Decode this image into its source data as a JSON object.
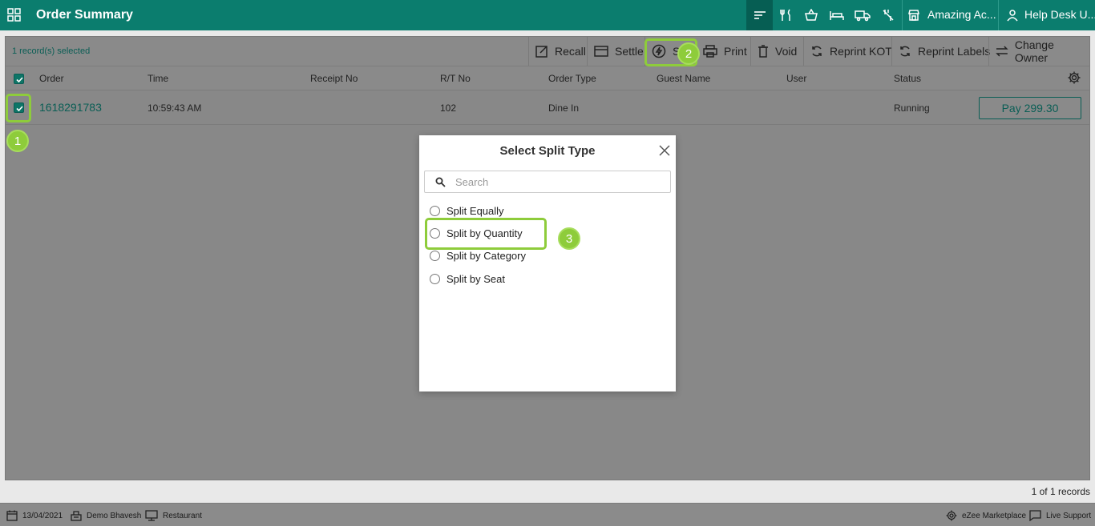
{
  "header": {
    "title": "Order Summary",
    "restaurant": "Amazing Ac...",
    "user": "Help Desk U..."
  },
  "toolbar": {
    "selected_text": "1 record(s) selected",
    "recall": "Recall",
    "settle": "Settle",
    "split": "Sp",
    "print": "Print",
    "void": "Void",
    "reprint_kot": "Reprint KOT",
    "reprint_labels": "Reprint Labels",
    "change_owner": "Change Owner"
  },
  "table": {
    "columns": [
      "Order",
      "Time",
      "Receipt No",
      "R/T No",
      "Order Type",
      "Guest Name",
      "User",
      "Status"
    ],
    "rows": [
      {
        "order": "1618291783",
        "time": "10:59:43 AM",
        "receipt_no": "",
        "rt_no": "102",
        "order_type": "Dine In",
        "guest_name": "",
        "user": "",
        "status": "Running",
        "pay_label": "Pay 299.30"
      }
    ]
  },
  "pagination": {
    "text": "1 of 1 records"
  },
  "annotations": {
    "step1": "1",
    "step2": "2",
    "step3": "3"
  },
  "modal": {
    "title": "Select Split Type",
    "search_placeholder": "Search",
    "options": [
      "Split Equally",
      "Split by Quantity",
      "Split by Category",
      "Split by Seat"
    ]
  },
  "statusbar": {
    "date": "13/04/2021",
    "user": "Demo Bhavesh",
    "terminal": "Restaurant",
    "marketplace": "eZee Marketplace",
    "support": "Live Support"
  },
  "colors": {
    "brand": "#0b7d6e",
    "highlight": "#8ecc3b"
  }
}
